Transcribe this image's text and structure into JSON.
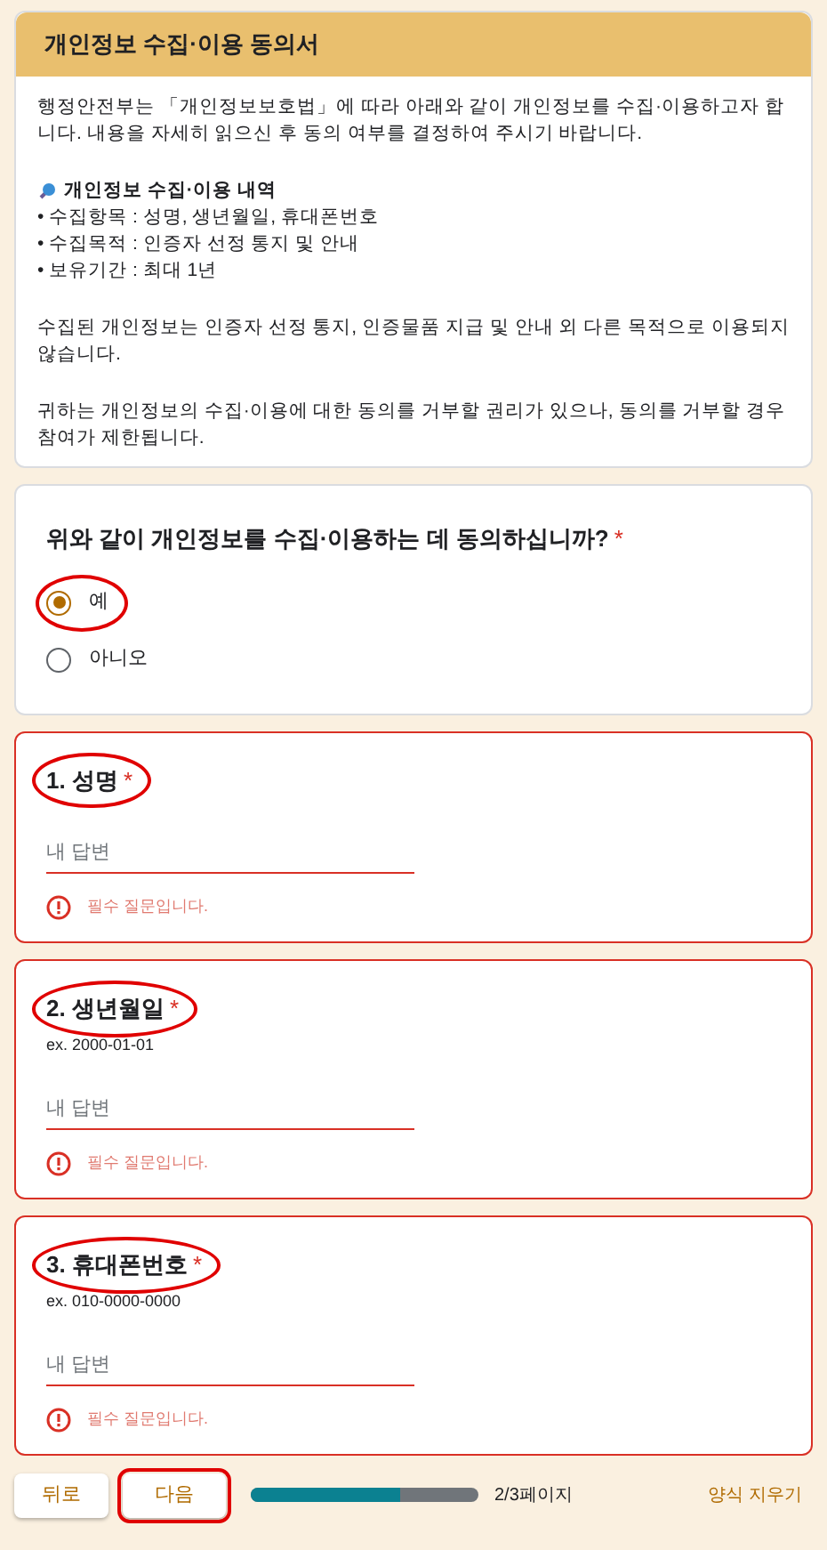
{
  "header": {
    "title": "개인정보 수집·이용 동의서"
  },
  "intro": {
    "paragraphs": [
      "행정안전부는 「개인정보보호법」에 따라 아래와 같이 개인정보를 수집·이용하고자 합니다. 내용을 자세히 읽으신 후 동의 여부를 결정하여 주시기 바랍니다."
    ],
    "section_title": "개인정보 수집·이용 내역",
    "bullets": [
      "• 수집항목 : 성명, 생년월일, 휴대폰번호",
      "• 수집목적 : 인증자 선정 통지 및 안내",
      "• 보유기간 : 최대 1년"
    ],
    "notes": [
      "수집된 개인정보는 인증자 선정 통지, 인증물품 지급 및 안내 외 다른 목적으로 이용되지 않습니다.",
      "귀하는 개인정보의 수집·이용에 대한 동의를 거부할 권리가 있으나, 동의를 거부할 경우 참여가 제한됩니다."
    ]
  },
  "consent": {
    "question": "위와 같이 개인정보를 수집·이용하는 데 동의하십니까?",
    "required_mark": "*",
    "options": [
      {
        "label": "예",
        "selected": true,
        "highlighted": true
      },
      {
        "label": "아니오",
        "selected": false,
        "highlighted": false
      }
    ]
  },
  "questions": [
    {
      "title": "1. 성명",
      "required_mark": "*",
      "highlighted": true,
      "placeholder": "내 답변",
      "error": "필수 질문입니다."
    },
    {
      "title": "2. 생년월일",
      "required_mark": "*",
      "highlighted": true,
      "hint": "ex. 2000-01-01",
      "placeholder": "내 답변",
      "error": "필수 질문입니다."
    },
    {
      "title": "3. 휴대폰번호",
      "required_mark": "*",
      "highlighted": true,
      "hint": "ex. 010-0000-0000",
      "placeholder": "내 답변",
      "error": "필수 질문입니다."
    }
  ],
  "footer": {
    "buttons": [
      {
        "label": "뒤로",
        "highlighted": false
      },
      {
        "label": "다음",
        "highlighted": true
      }
    ],
    "progress": {
      "level": 0.66,
      "label": "2/3페이지"
    },
    "clear": "양식 지우기"
  }
}
